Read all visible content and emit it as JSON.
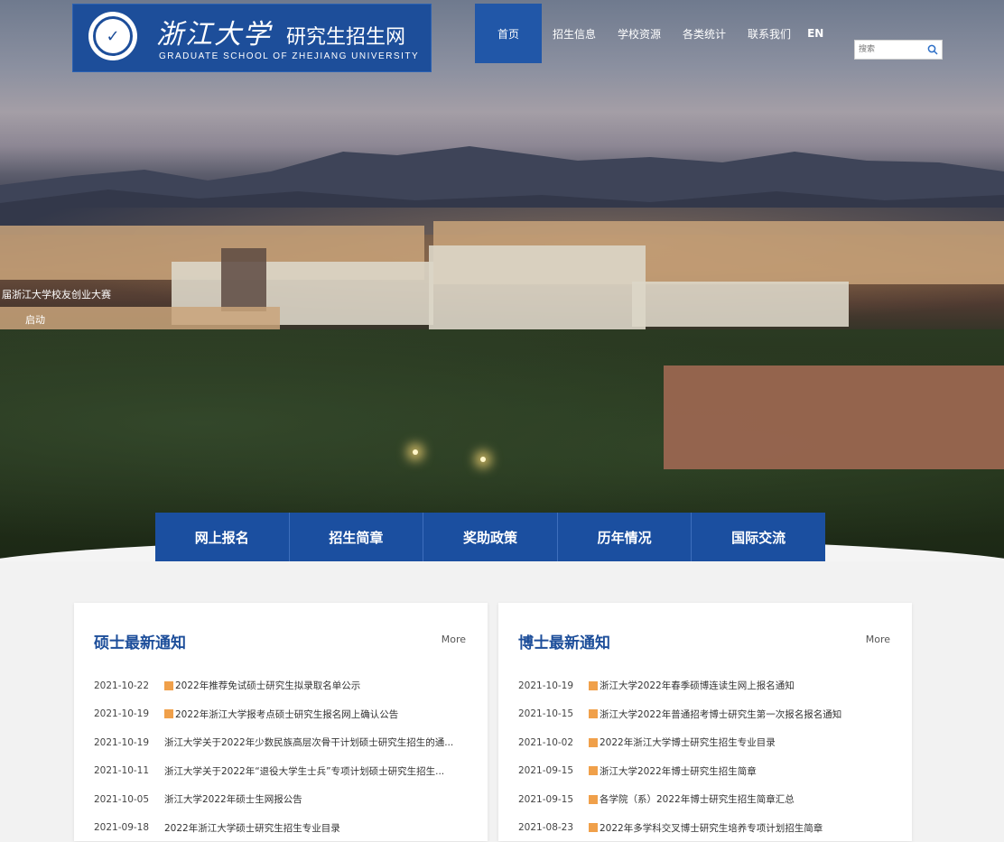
{
  "header": {
    "logo_cn": "浙江大学",
    "logo_sub": "研究生招生网",
    "logo_en": "GRADUATE SCHOOL OF ZHEJIANG UNIVERSITY",
    "nav": [
      "首页",
      "招生信息",
      "学校资源",
      "各类统计",
      "联系我们"
    ],
    "lang": "EN",
    "search_placeholder": "搜索"
  },
  "hero": {
    "caption_line1": "届浙江大学校友创业大赛",
    "caption_line2": "启动"
  },
  "quick_nav": [
    "网上报名",
    "招生简章",
    "奖助政策",
    "历年情况",
    "国际交流"
  ],
  "masters": {
    "title": "硕士最新通知",
    "more": "More",
    "items": [
      {
        "date": "2021-10-22",
        "tag": true,
        "text": "2022年推荐免试硕士研究生拟录取名单公示"
      },
      {
        "date": "2021-10-19",
        "tag": true,
        "text": "2022年浙江大学报考点硕士研究生报名网上确认公告"
      },
      {
        "date": "2021-10-19",
        "tag": false,
        "text": "浙江大学关于2022年少数民族高层次骨干计划硕士研究生招生的通..."
      },
      {
        "date": "2021-10-11",
        "tag": false,
        "text": "浙江大学关于2022年“退役大学生士兵”专项计划硕士研究生招生..."
      },
      {
        "date": "2021-10-05",
        "tag": false,
        "text": "浙江大学2022年硕士生网报公告"
      },
      {
        "date": "2021-09-18",
        "tag": false,
        "text": "2022年浙江大学硕士研究生招生专业目录"
      }
    ]
  },
  "doctoral": {
    "title": "博士最新通知",
    "more": "More",
    "items": [
      {
        "date": "2021-10-19",
        "tag": true,
        "text": "浙江大学2022年春季硕博连读生网上报名通知"
      },
      {
        "date": "2021-10-15",
        "tag": true,
        "text": "浙江大学2022年普通招考博士研究生第一次报名报名通知"
      },
      {
        "date": "2021-10-02",
        "tag": true,
        "text": "2022年浙江大学博士研究生招生专业目录"
      },
      {
        "date": "2021-09-15",
        "tag": true,
        "text": "浙江大学2022年博士研究生招生简章"
      },
      {
        "date": "2021-09-15",
        "tag": true,
        "text": "各学院（系）2022年博士研究生招生简章汇总"
      },
      {
        "date": "2021-08-23",
        "tag": true,
        "text": "2022年多学科交叉博士研究生培养专项计划招生简章"
      }
    ]
  },
  "colors": {
    "brand_blue": "#1d4e9a",
    "tag_orange": "#f0a04a"
  }
}
